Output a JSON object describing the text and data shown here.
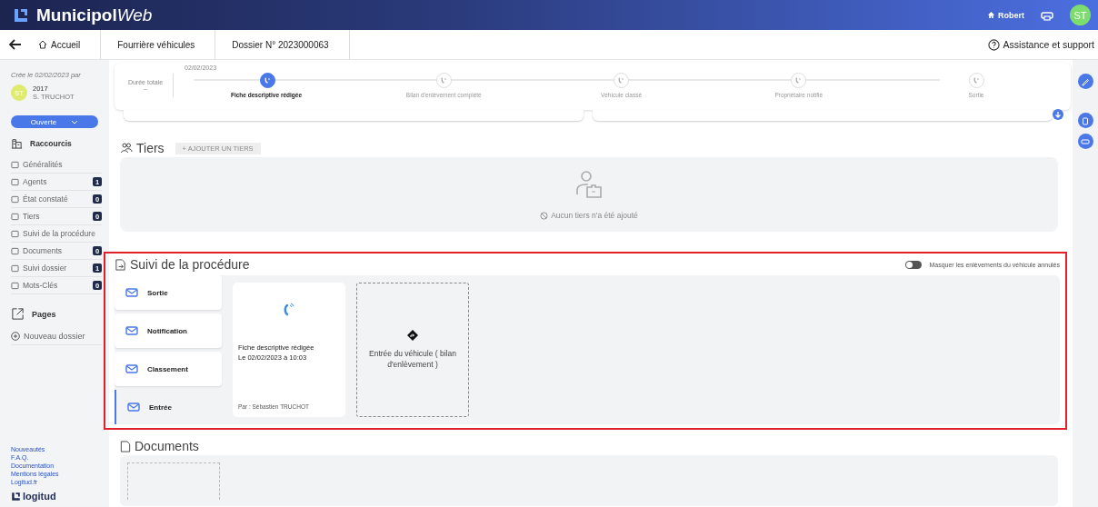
{
  "header": {
    "logo_bold": "Municipol",
    "logo_italic": "Web",
    "user": "Robert",
    "avatar": "ST"
  },
  "breadcrumb": {
    "home": "Accueil",
    "items": [
      "Fourrière véhicules",
      "Dossier N° 2023000063"
    ],
    "help": "Assistance et support"
  },
  "sidebar": {
    "created": "Crée le 02/02/2023 par",
    "avatar": "ST",
    "code": "2017",
    "name": "S. TRUCHOT",
    "status": "Ouverte",
    "shortcuts_title": "Raccourcis",
    "items": [
      {
        "label": "Généralités"
      },
      {
        "label": "Agents",
        "count": "1"
      },
      {
        "label": "État constaté",
        "count": "0"
      },
      {
        "label": "Tiers",
        "count": "0"
      },
      {
        "label": "Suivi de la procédure"
      },
      {
        "label": "Documents",
        "count": "0"
      },
      {
        "label": "Suivi dossier",
        "count": "1"
      },
      {
        "label": "Mots-Clés",
        "count": "0"
      }
    ],
    "pages_title": "Pages",
    "new_label": "Nouveau dossier",
    "links": [
      "Nouveautés",
      "F.A.Q.",
      "Documentation",
      "Mentions légales",
      "Logitud.fr"
    ],
    "brand": "logitud"
  },
  "timeline": {
    "total_label": "Durée totale",
    "total_value": "--",
    "date": "02/02/2023",
    "steps": [
      {
        "label": "Fiche descriptive rédigée",
        "done": true
      },
      {
        "label": "Bilan d'enlèvement complété",
        "done": false
      },
      {
        "label": "Véhicule classé",
        "done": false
      },
      {
        "label": "Propriétaire notifié",
        "done": false
      },
      {
        "label": "Sortie",
        "done": false
      }
    ]
  },
  "tiers": {
    "title": "Tiers",
    "add_button": "+ AJOUTER UN TIERS",
    "empty_text": "Aucun tiers n'a été ajouté"
  },
  "suivi": {
    "title": "Suivi de la procédure",
    "toggle": {
      "label": "Masquer les enlèvements du véhicule annulés",
      "on": false
    },
    "tabs": [
      {
        "label": "Sortie",
        "selected": false
      },
      {
        "label": "Notification",
        "selected": false
      },
      {
        "label": "Classement",
        "selected": false
      },
      {
        "label": "Entrée",
        "selected": true
      }
    ],
    "cards": [
      {
        "kind": "event",
        "title": "Fiche descriptive rédigée",
        "date": "Le 02/02/2023 à 10:03",
        "author": "Par : Sébastien TRUCHOT"
      },
      {
        "kind": "pending",
        "label": "Entrée du véhicule ( bilan d'enlèvement )"
      }
    ]
  },
  "documents": {
    "title": "Documents"
  }
}
